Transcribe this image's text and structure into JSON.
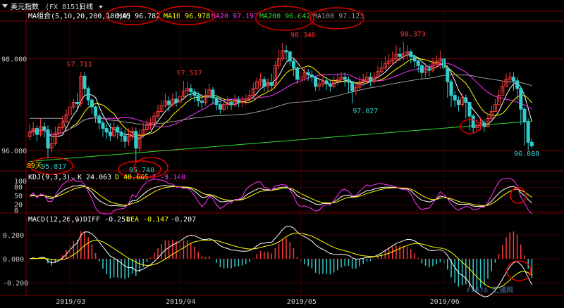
{
  "titlebar": {
    "symbol_name": "美元指数",
    "symbol_code": "(FX 8151)",
    "period": "日线"
  },
  "ma_legend": {
    "group_label": "MA组合(5,10,20,200,100,0)",
    "items": [
      {
        "label": "MA5 96.782",
        "color": "#ffffff"
      },
      {
        "label": "MA10 96.978",
        "color": "#ffff00"
      },
      {
        "label": "MA20 97.197",
        "color": "#ff33ff"
      },
      {
        "label": "MA200 96.642",
        "color": "#33dd33"
      },
      {
        "label": "MA100 97.123",
        "color": "#9a9a9a"
      }
    ]
  },
  "price_panel": {
    "y_ticks": [
      {
        "value": 98.0,
        "label": "98.000"
      },
      {
        "value": 96.0,
        "label": "96.000"
      }
    ],
    "annotations": [
      {
        "text": "97.711",
        "color": "#ff3333",
        "x": 13,
        "v": 97.711,
        "circled": false
      },
      {
        "text": "97.517",
        "color": "#ff3333",
        "x": 43,
        "v": 97.517,
        "circled": false
      },
      {
        "text": "98.346",
        "color": "#ff3333",
        "x": 74,
        "v": 98.346,
        "circled": false
      },
      {
        "text": "98.373",
        "color": "#ff3333",
        "x": 104,
        "v": 98.373,
        "circled": false
      },
      {
        "text": "97.027",
        "color": "#33cccc",
        "x": 91,
        "v": 97.027,
        "circled": false
      },
      {
        "text": "95.817",
        "color": "#33cccc",
        "x": 6,
        "v": 95.817,
        "circled": true
      },
      {
        "text": "95.740",
        "color": "#33cccc",
        "x": 30,
        "v": 95.74,
        "circled": true
      },
      {
        "text": "96.088",
        "color": "#33cccc",
        "x": 135,
        "v": 96.088,
        "circled": false
      }
    ],
    "bars_label": "89天"
  },
  "kdj_panel": {
    "label": "KDJ(9,3,3)",
    "k_label": "K 24.063",
    "d_label": "D 40.665",
    "j_label": "J -9.140",
    "y_ticks": [
      "100",
      "80",
      "50",
      "20",
      "0"
    ]
  },
  "macd_panel": {
    "label": "MACD(12,26,9)",
    "diff_label": "DIFF -0.251",
    "dea_label": "DEA -0.147",
    "macd_label": "-0.207",
    "y_ticks": [
      {
        "value": 0.2,
        "label": "0.200"
      },
      {
        "value": 0.0,
        "label": "0.000"
      },
      {
        "value": -0.2,
        "label": "-0.200"
      }
    ]
  },
  "x_axis": {
    "labels": [
      {
        "text": "2019/03",
        "x": 11
      },
      {
        "text": "2019/04",
        "x": 41
      },
      {
        "text": "2019/05",
        "x": 74
      },
      {
        "text": "2019/06",
        "x": 113
      }
    ]
  },
  "watermark": "FX678 汇通网",
  "chart_data": [
    {
      "type": "candlestick",
      "title": "美元指数 (FX 8151) 日线",
      "ylim": [
        95.6,
        98.7
      ],
      "x": [
        0,
        1,
        2,
        3,
        4,
        5,
        6,
        7,
        8,
        9,
        10,
        11,
        12,
        13,
        14,
        15,
        16,
        17,
        18,
        19,
        20,
        21,
        22,
        23,
        24,
        25,
        26,
        27,
        28,
        29,
        30,
        31,
        32,
        33,
        34,
        35,
        36,
        37,
        38,
        39,
        40,
        41,
        42,
        43,
        44,
        45,
        46,
        47,
        48,
        49,
        50,
        51,
        52,
        53,
        54,
        55,
        56,
        57,
        58,
        59,
        60,
        61,
        62,
        63,
        64,
        65,
        66,
        67,
        68,
        69,
        70,
        71,
        72,
        73,
        74,
        75,
        76,
        77,
        78,
        79,
        80,
        81,
        82,
        83,
        84,
        85,
        86,
        87,
        88,
        89,
        90,
        91,
        92,
        93,
        94,
        95,
        96,
        97,
        98,
        99,
        100,
        101,
        102,
        103,
        104,
        105,
        106,
        107,
        108,
        109,
        110,
        111,
        112,
        113,
        114,
        115,
        116,
        117,
        118,
        119,
        120,
        121,
        122,
        123,
        124,
        125,
        126,
        127,
        128,
        129,
        130,
        131,
        132,
        133,
        134,
        135,
        136,
        137
      ],
      "close": [
        96.4,
        96.48,
        96.35,
        96.52,
        96.45,
        96.05,
        96.15,
        96.38,
        96.5,
        96.62,
        96.78,
        96.95,
        97.05,
        97.02,
        97.62,
        97.35,
        97.1,
        96.95,
        96.75,
        96.6,
        96.48,
        96.4,
        96.32,
        96.5,
        96.4,
        96.32,
        96.2,
        96.3,
        96.42,
        96.05,
        96.35,
        96.45,
        96.55,
        96.6,
        96.75,
        96.85,
        96.98,
        97.08,
        97.0,
        97.12,
        97.05,
        97.18,
        97.3,
        97.35,
        97.28,
        97.2,
        97.08,
        97.05,
        97.2,
        97.32,
        97.15,
        97.0,
        96.9,
        97.0,
        97.05,
        97.0,
        97.1,
        97.05,
        97.08,
        97.12,
        97.2,
        97.35,
        97.5,
        97.55,
        97.4,
        97.48,
        97.42,
        97.85,
        98.0,
        98.18,
        98.15,
        97.95,
        97.8,
        97.55,
        97.6,
        97.7,
        97.65,
        97.6,
        97.4,
        97.45,
        97.52,
        97.45,
        97.4,
        97.5,
        97.55,
        97.6,
        97.55,
        97.5,
        97.3,
        97.38,
        97.5,
        97.55,
        97.6,
        97.52,
        97.6,
        97.72,
        97.8,
        97.9,
        97.95,
        98.0,
        98.1,
        98.05,
        98.12,
        98.15,
        98.05,
        97.95,
        97.85,
        97.7,
        97.78,
        97.75,
        97.9,
        97.95,
        98.0,
        97.8,
        97.5,
        97.2,
        97.1,
        97.0,
        97.15,
        97.05,
        96.75,
        96.5,
        96.55,
        96.6,
        96.52,
        96.7,
        96.85,
        97.0,
        97.2,
        97.4,
        97.55,
        97.6,
        97.52,
        97.35,
        96.9,
        96.62,
        96.18,
        96.1
      ],
      "high": [
        96.58,
        96.62,
        96.55,
        96.7,
        96.62,
        96.55,
        96.45,
        96.52,
        96.6,
        96.75,
        96.9,
        97.08,
        97.12,
        97.25,
        97.71,
        97.7,
        97.4,
        97.15,
        96.98,
        96.8,
        96.65,
        96.58,
        96.6,
        96.65,
        96.55,
        96.5,
        96.45,
        96.48,
        96.52,
        96.5,
        96.48,
        96.6,
        96.68,
        96.72,
        96.85,
        97.0,
        97.1,
        97.25,
        97.18,
        97.25,
        97.28,
        97.35,
        97.52,
        97.5,
        97.45,
        97.35,
        97.28,
        97.22,
        97.35,
        97.45,
        97.38,
        97.18,
        97.08,
        97.1,
        97.18,
        97.12,
        97.22,
        97.18,
        97.18,
        97.22,
        97.32,
        97.48,
        97.6,
        97.68,
        97.62,
        97.58,
        97.68,
        97.95,
        98.2,
        98.35,
        98.3,
        98.18,
        98.0,
        97.85,
        97.72,
        97.8,
        97.78,
        97.75,
        97.62,
        97.58,
        97.65,
        97.6,
        97.55,
        97.62,
        97.68,
        97.72,
        97.7,
        97.62,
        97.52,
        97.5,
        97.62,
        97.68,
        97.72,
        97.7,
        97.72,
        97.85,
        97.95,
        98.05,
        98.1,
        98.15,
        98.3,
        98.25,
        98.37,
        98.3,
        98.2,
        98.1,
        98.0,
        97.9,
        97.9,
        97.88,
        98.02,
        98.08,
        98.18,
        98.05,
        97.85,
        97.55,
        97.3,
        97.18,
        97.25,
        97.22,
        97.05,
        96.8,
        96.7,
        96.72,
        96.68,
        96.8,
        96.98,
        97.12,
        97.32,
        97.52,
        97.68,
        97.72,
        97.7,
        97.6,
        97.4,
        96.95,
        96.7,
        96.25
      ],
      "low": [
        96.22,
        96.32,
        96.2,
        96.3,
        96.28,
        95.82,
        95.95,
        96.1,
        96.32,
        96.45,
        96.6,
        96.8,
        96.9,
        96.85,
        96.95,
        97.2,
        96.98,
        96.8,
        96.6,
        96.45,
        96.3,
        96.25,
        96.2,
        96.28,
        96.25,
        96.18,
        96.05,
        96.1,
        96.22,
        95.74,
        95.95,
        96.28,
        96.4,
        96.45,
        96.58,
        96.7,
        96.82,
        96.92,
        96.85,
        96.95,
        96.95,
        97.0,
        97.1,
        97.2,
        97.15,
        97.05,
        96.95,
        96.9,
        96.98,
        97.15,
        97.0,
        96.88,
        96.8,
        96.85,
        96.9,
        96.88,
        96.95,
        96.95,
        96.95,
        97.0,
        97.05,
        97.18,
        97.32,
        97.38,
        97.28,
        97.3,
        97.3,
        97.35,
        97.78,
        97.95,
        97.98,
        97.85,
        97.62,
        97.45,
        97.42,
        97.52,
        97.52,
        97.48,
        97.3,
        97.3,
        97.38,
        97.32,
        97.28,
        97.35,
        97.42,
        97.48,
        97.4,
        97.25,
        97.03,
        97.2,
        97.3,
        97.4,
        97.45,
        97.4,
        97.45,
        97.55,
        97.65,
        97.75,
        97.8,
        97.85,
        97.9,
        97.95,
        97.98,
        98.0,
        97.9,
        97.8,
        97.7,
        97.55,
        97.6,
        97.62,
        97.7,
        97.8,
        97.78,
        97.5,
        97.15,
        96.95,
        96.95,
        96.85,
        96.95,
        96.7,
        96.45,
        96.38,
        96.4,
        96.45,
        96.4,
        96.5,
        96.68,
        96.85,
        97.05,
        97.25,
        97.4,
        97.45,
        97.3,
        97.1,
        96.55,
        96.1,
        96.0,
        96.05
      ],
      "ma_series": [
        {
          "name": "MA5",
          "color": "#ffffff"
        },
        {
          "name": "MA10",
          "color": "#ffff00"
        },
        {
          "name": "MA20",
          "color": "#ff33ff"
        },
        {
          "name": "MA200",
          "color": "#33dd33"
        },
        {
          "name": "MA100",
          "color": "#9a9a9a"
        }
      ]
    }
  ]
}
